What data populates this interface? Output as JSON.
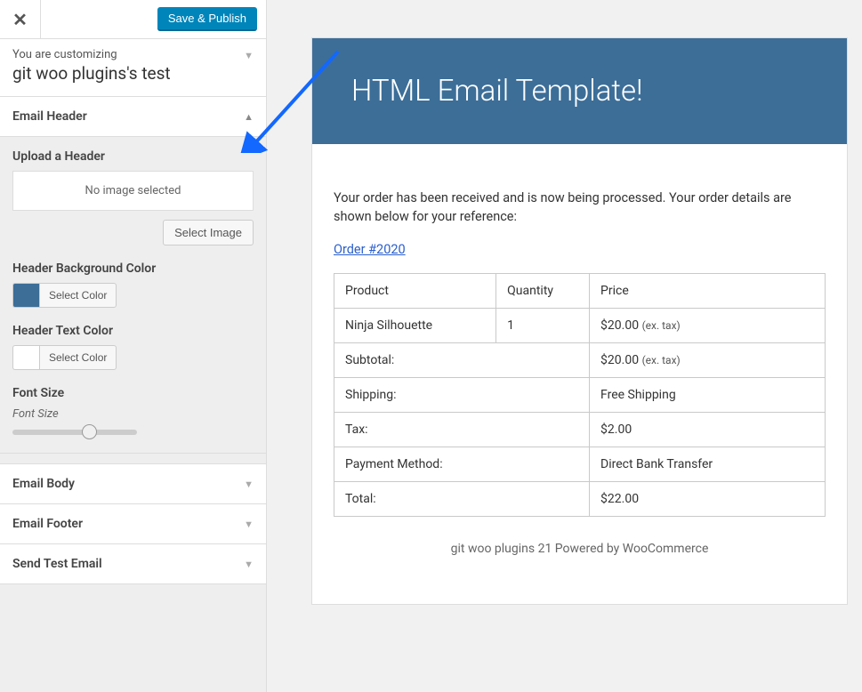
{
  "topbar": {
    "close_glyph": "✕",
    "save_label": "Save & Publish"
  },
  "info": {
    "customizing_label": "You are customizing",
    "site_title": "git woo plugins's test"
  },
  "sections": {
    "email_header": {
      "title": "Email Header",
      "upload_label": "Upload a Header",
      "no_image_text": "No image selected",
      "select_image_btn": "Select Image",
      "bg_color_label": "Header Background Color",
      "bg_color_value": "#3c6e98",
      "select_color_btn": "Select Color",
      "text_color_label": "Header Text Color",
      "text_color_value": "#ffffff",
      "font_size_label": "Font Size",
      "font_size_desc": "Font Size"
    },
    "email_body": {
      "title": "Email Body"
    },
    "email_footer": {
      "title": "Email Footer"
    },
    "send_test": {
      "title": "Send Test Email"
    }
  },
  "preview": {
    "header_title": "HTML Email Template!",
    "intro_text": "Your order has been received and is now being processed. Your order details are shown below for your reference:",
    "order_link": "Order #2020",
    "table_head": {
      "product": "Product",
      "quantity": "Quantity",
      "price": "Price"
    },
    "items": [
      {
        "product": "Ninja Silhouette",
        "quantity": "1",
        "price": "$20.00",
        "extax": "(ex. tax)"
      }
    ],
    "summary": [
      {
        "label": "Subtotal:",
        "value": "$20.00",
        "extax": "(ex. tax)"
      },
      {
        "label": "Shipping:",
        "value": "Free Shipping"
      },
      {
        "label": "Tax:",
        "value": "$2.00"
      },
      {
        "label": "Payment Method:",
        "value": "Direct Bank Transfer"
      },
      {
        "label": "Total:",
        "value": "$22.00"
      }
    ],
    "footer_text": "git woo plugins 21 Powered by WooCommerce"
  }
}
